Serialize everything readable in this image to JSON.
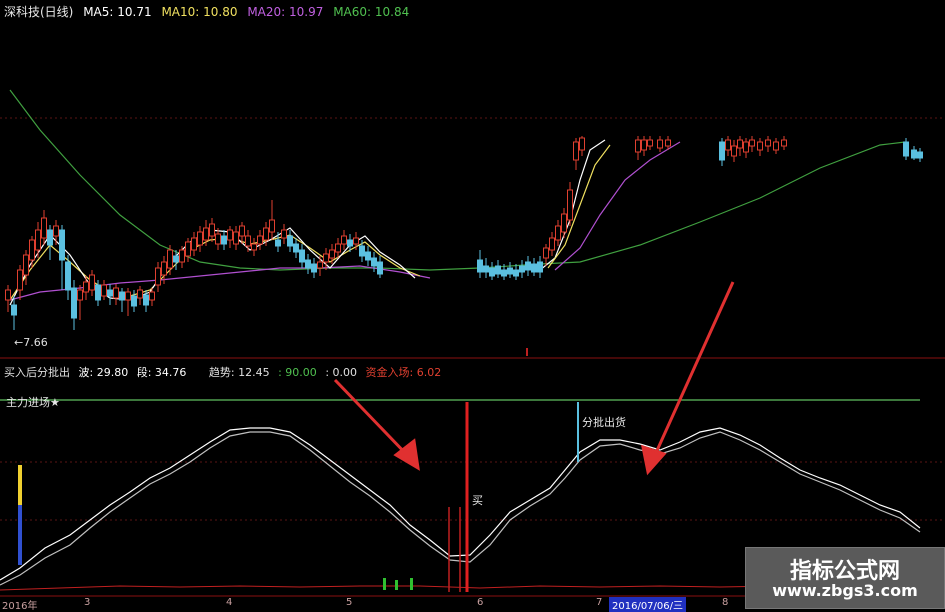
{
  "header": {
    "stock": "深科技(日线)",
    "ma5": "MA5: 10.71",
    "ma10": "MA10: 10.80",
    "ma20": "MA20: 10.97",
    "ma60": "MA60: 10.84"
  },
  "price_low_label": "←7.66",
  "indicator": {
    "name": "买入后分批出",
    "wave": "波: 29.80",
    "segment": "段: 34.76",
    "trend": "趋势: 12.45",
    "value1": ": 90.00",
    "value2": ": 0.00",
    "funds": "资金入场: 6.02"
  },
  "signal_line_label": "主力进场★",
  "annotations": {
    "buy": "买",
    "sell": "分批出货"
  },
  "date_axis": {
    "year": "2016年",
    "months": [
      "3",
      "4",
      "5",
      "6",
      "7",
      "8"
    ],
    "highlight": "2016/07/06/三"
  },
  "watermark": {
    "title": "指标公式网",
    "url": "www.zbgs3.com"
  },
  "colors": {
    "up": "#e04030",
    "down": "#5bc0e0",
    "ma5": "#ffffff",
    "ma10": "#f0e060",
    "ma20": "#b050d0",
    "ma60": "#40a040",
    "signal_line": "#60c060",
    "arrow": "#e03030"
  }
}
